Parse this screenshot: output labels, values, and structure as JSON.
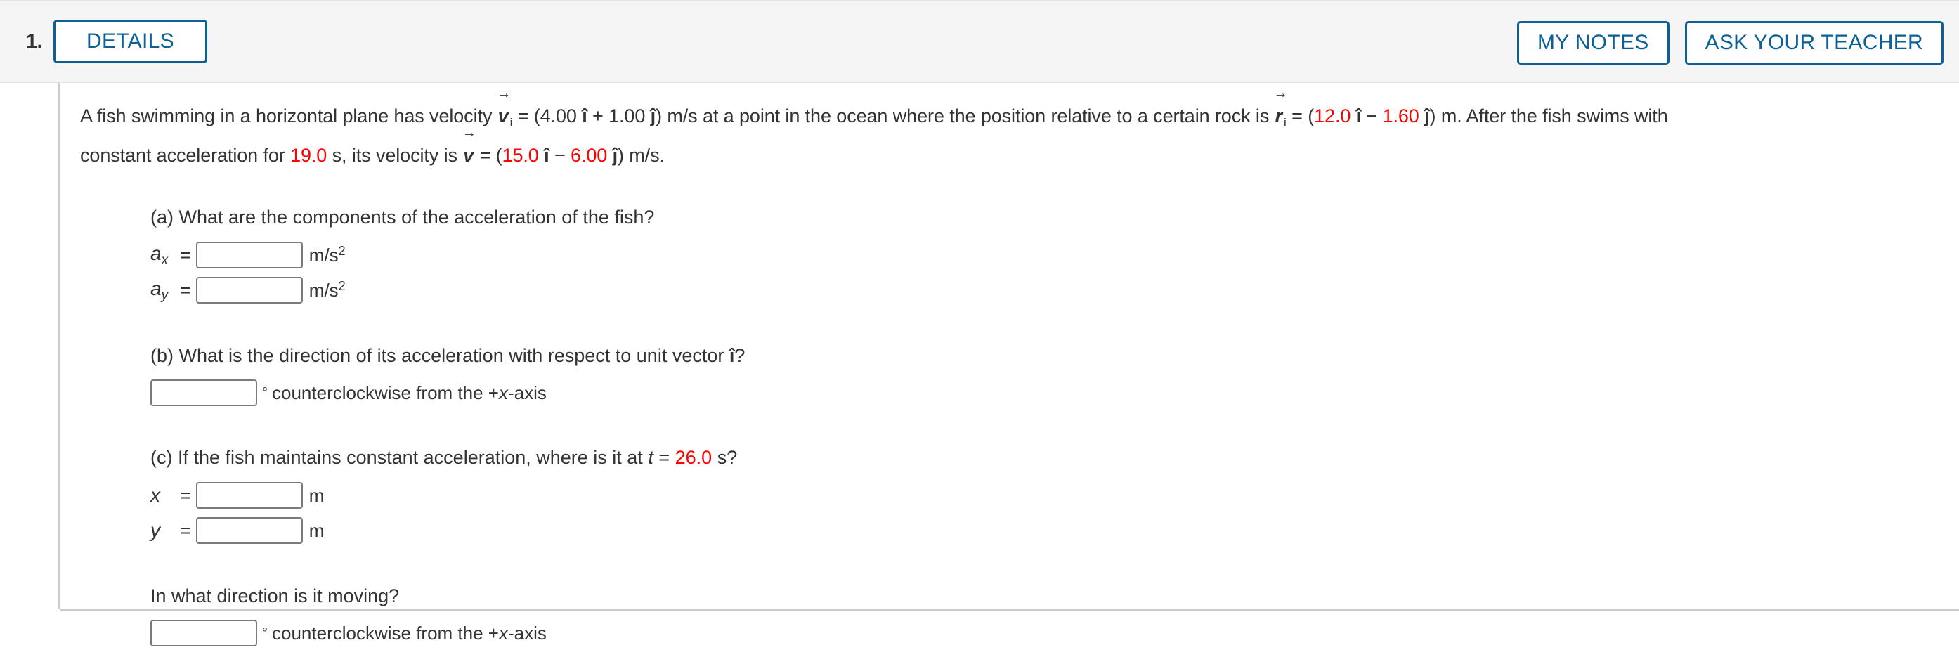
{
  "header": {
    "question_number": "1.",
    "details_label": "DETAILS",
    "my_notes_label": "MY NOTES",
    "ask_teacher_label": "ASK YOUR TEACHER",
    "accent_color": "#0b6096",
    "background_color": "#f5f5f5"
  },
  "problem": {
    "line1_a": "A fish swimming in a horizontal plane has velocity ",
    "v_symbol": "v",
    "v_sub": "i",
    "line1_b": " = (4.00 ",
    "ihat": "î",
    "line1_c": " + 1.00 ",
    "jhat": "ĵ",
    "line1_d": ") m/s at a point in the ocean where the position relative to a certain rock is ",
    "r_symbol": "r",
    "r_sub": "i",
    "line1_e": " = (",
    "r_x": "12.0",
    "line1_f": " − ",
    "r_y": "1.60",
    "line1_g": ") m. After the fish swims with",
    "line2_a": "constant acceleration for ",
    "time_1": "19.0",
    "line2_b": " s, its velocity is ",
    "vf_symbol": "v",
    "line2_c": " = (",
    "vf_x": "15.0",
    "line2_d": " − ",
    "vf_y": "6.00",
    "line2_e": ") m/s.",
    "red_color": "#ff0000"
  },
  "parts": {
    "a": {
      "question": "(a) What are the components of the acceleration of the fish?",
      "rows": [
        {
          "label": "a",
          "sub": "x",
          "value": "",
          "unit": "m/s",
          "exp": "2"
        },
        {
          "label": "a",
          "sub": "y",
          "value": "",
          "unit": "m/s",
          "exp": "2"
        }
      ]
    },
    "b": {
      "question_pre": "(b) What is the direction of its acceleration with respect to unit vector ",
      "question_hat": "î",
      "question_post": "?",
      "answer_value": "",
      "degree_symbol": "°",
      "suffix_pre": " counterclockwise from the +",
      "suffix_var": "x",
      "suffix_post": "-axis"
    },
    "c": {
      "question_pre": "(c) If the fish maintains constant acceleration, where is it at ",
      "question_var": "t",
      "question_eq": " = ",
      "question_time": "26.0",
      "question_post": " s?",
      "rows": [
        {
          "label": "x",
          "value": "",
          "unit": "m"
        },
        {
          "label": "y",
          "value": "",
          "unit": "m"
        }
      ]
    },
    "d": {
      "question": "In what direction is it moving?",
      "answer_value": "",
      "degree_symbol": "°",
      "suffix_pre": " counterclockwise from the +",
      "suffix_var": "x",
      "suffix_post": "-axis"
    }
  }
}
